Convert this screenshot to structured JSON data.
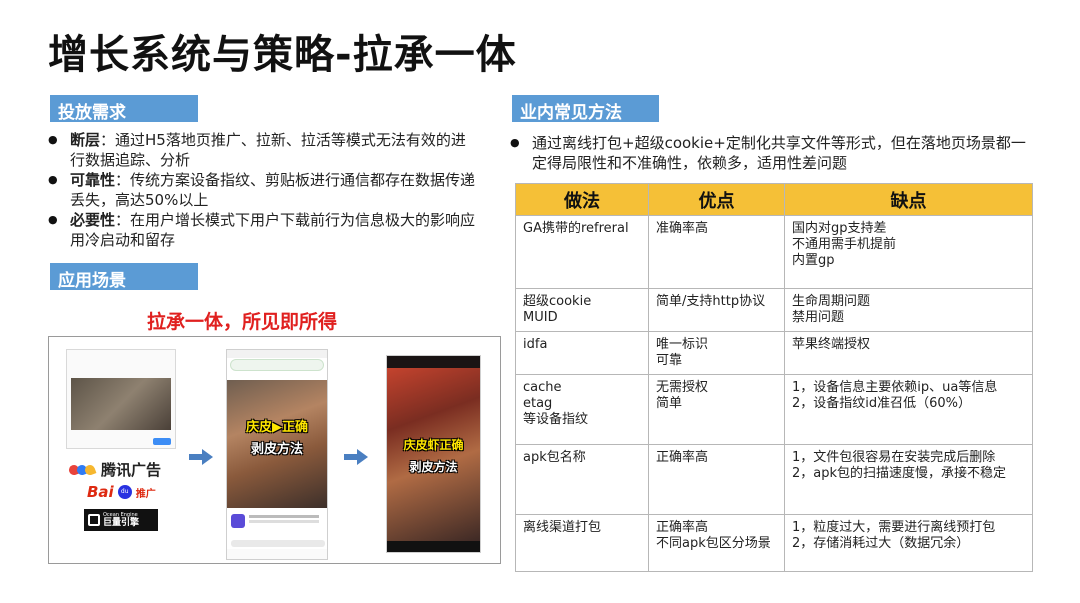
{
  "title": "增长系统与策略-拉承一体",
  "left": {
    "demand_label": "投放需求",
    "bullets": [
      {
        "term": "断层",
        "text": "：通过H5落地页推广、拉新、拉活等模式无法有效的进行数据追踪、分析"
      },
      {
        "term": "可靠性",
        "text": "：传统方案设备指纹、剪贴板进行通信都存在数据传递丢失，高达50%以上"
      },
      {
        "term": "必要性",
        "text": "：在用户增长模式下用户下载前行为信息极大的影响应用冷启动和留存"
      }
    ],
    "scene_label": "应用场景",
    "scene_caption": "拉承一体，所见即所得",
    "logos": {
      "tencent": "腾讯广告",
      "baidu": "Bai",
      "baidu_paw": "du",
      "baidu_suffix": "推广",
      "ocean_top": "Ocean Engine",
      "ocean_main": "巨量引擎"
    },
    "video_caption_top": "庆皮▶正确",
    "video_caption_bottom": "剥皮方法",
    "video2_caption_top": "庆皮虾正确",
    "video2_caption_bottom": "剥皮方法"
  },
  "right": {
    "methods_label": "业内常见方法",
    "intro": "通过离线打包+超级cookie+定制化共享文件等形式，但在落地页场景都一定得局限性和不准确性，依赖多，适用性差问题",
    "table": {
      "headers": [
        "做法",
        "优点",
        "缺点"
      ],
      "rows": [
        {
          "method": [
            "GA携带的refreral"
          ],
          "pros": [
            "准确率高"
          ],
          "cons": [
            "国内对gp支持差",
            "不通用需手机提前",
            "内置gp"
          ]
        },
        {
          "method": [
            "超级cookie",
            "MUID"
          ],
          "pros": [
            "简单/支持http协议"
          ],
          "cons": [
            "生命周期问题",
            "禁用问题"
          ]
        },
        {
          "method": [
            "idfa"
          ],
          "pros": [
            "唯一标识",
            "可靠"
          ],
          "cons": [
            "苹果终端授权"
          ]
        },
        {
          "method": [
            "cache",
            "etag",
            "等设备指纹"
          ],
          "pros": [
            "无需授权",
            "简单"
          ],
          "cons": [
            "1，设备信息主要依赖ip、ua等信息",
            "2，设备指纹id准召低（60%）"
          ]
        },
        {
          "method": [
            "apk包名称"
          ],
          "pros": [
            "正确率高"
          ],
          "cons": [
            "1，文件包很容易在安装完成后删除",
            "2，apk包的扫描速度慢，承接不稳定"
          ]
        },
        {
          "method": [
            "离线渠道打包"
          ],
          "pros": [
            "正确率高",
            "不同apk包区分场景"
          ],
          "cons": [
            "1，粒度过大，需要进行离线预打包",
            "2，存储消耗过大（数据冗余）"
          ]
        }
      ]
    }
  },
  "colors": {
    "label_bg": "#5b9bd5",
    "table_header_bg": "#f5c037",
    "caption_red": "#e0201f",
    "arrow_blue": "#4a7fc1"
  }
}
